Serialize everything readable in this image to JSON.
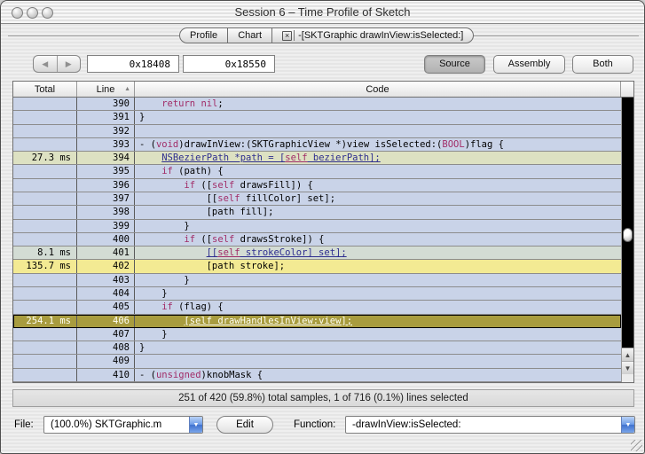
{
  "window": {
    "title": "Session 6 – Time Profile of Sketch"
  },
  "tabs": [
    {
      "label": "Profile"
    },
    {
      "label": "Chart"
    },
    {
      "label": "-[SKTGraphic drawInView:isSelected:]",
      "close_glyph": "×",
      "active": true
    }
  ],
  "toolbar": {
    "back_glyph": "◀",
    "forward_glyph": "▶",
    "address_start": "0x18408",
    "address_end": "0x18550",
    "view_buttons": [
      {
        "label": "Source",
        "selected": true
      },
      {
        "label": "Assembly",
        "selected": false
      },
      {
        "label": "Both",
        "selected": false
      }
    ]
  },
  "table": {
    "columns": {
      "total": "Total",
      "line": "Line",
      "code": "Code"
    },
    "sort_arrow": "▲",
    "rows": [
      {
        "total": "",
        "line": "390",
        "indent": 4,
        "style": "normal",
        "code": [
          {
            "t": "return nil",
            "c": "kw"
          },
          {
            "t": ";",
            "c": "plain"
          }
        ]
      },
      {
        "total": "",
        "line": "391",
        "indent": 0,
        "style": "normal",
        "code": [
          {
            "t": "}",
            "c": "plain"
          }
        ]
      },
      {
        "total": "",
        "line": "392",
        "indent": 0,
        "style": "normal",
        "code": []
      },
      {
        "total": "",
        "line": "393",
        "indent": 0,
        "style": "normal",
        "code": [
          {
            "t": "- (",
            "c": "plain"
          },
          {
            "t": "void",
            "c": "kw"
          },
          {
            "t": ")drawInView:(SKTGraphicView *)view isSelected:(",
            "c": "plain"
          },
          {
            "t": "BOOL",
            "c": "kw"
          },
          {
            "t": ")flag {",
            "c": "plain"
          }
        ]
      },
      {
        "total": "27.3 ms",
        "line": "394",
        "indent": 4,
        "style": "green",
        "code": [
          {
            "t": "NSBezierPath *path = [",
            "c": "link"
          },
          {
            "t": "self",
            "c": "linkkw"
          },
          {
            "t": " bezierPath];",
            "c": "link"
          }
        ]
      },
      {
        "total": "",
        "line": "395",
        "indent": 4,
        "style": "normal",
        "code": [
          {
            "t": "if",
            "c": "kw"
          },
          {
            "t": " (path) {",
            "c": "plain"
          }
        ]
      },
      {
        "total": "",
        "line": "396",
        "indent": 8,
        "style": "normal",
        "code": [
          {
            "t": "if",
            "c": "kw"
          },
          {
            "t": " ([",
            "c": "plain"
          },
          {
            "t": "self",
            "c": "kw"
          },
          {
            "t": " drawsFill]) {",
            "c": "plain"
          }
        ]
      },
      {
        "total": "",
        "line": "397",
        "indent": 12,
        "style": "normal",
        "code": [
          {
            "t": "[[",
            "c": "plain"
          },
          {
            "t": "self",
            "c": "kw"
          },
          {
            "t": " fillColor] set];",
            "c": "plain"
          }
        ]
      },
      {
        "total": "",
        "line": "398",
        "indent": 12,
        "style": "normal",
        "code": [
          {
            "t": "[path fill];",
            "c": "plain"
          }
        ]
      },
      {
        "total": "",
        "line": "399",
        "indent": 8,
        "style": "normal",
        "code": [
          {
            "t": "}",
            "c": "plain"
          }
        ]
      },
      {
        "total": "",
        "line": "400",
        "indent": 8,
        "style": "normal",
        "code": [
          {
            "t": "if",
            "c": "kw"
          },
          {
            "t": " ([",
            "c": "plain"
          },
          {
            "t": "self",
            "c": "kw"
          },
          {
            "t": " drawsStroke]) {",
            "c": "plain"
          }
        ]
      },
      {
        "total": "8.1 ms",
        "line": "401",
        "indent": 12,
        "style": "sage",
        "code": [
          {
            "t": "[[",
            "c": "link"
          },
          {
            "t": "self",
            "c": "linkkw"
          },
          {
            "t": " strokeColor] set];",
            "c": "link"
          }
        ]
      },
      {
        "total": "135.7 ms",
        "line": "402",
        "indent": 12,
        "style": "yellow",
        "code": [
          {
            "t": "[path stroke];",
            "c": "plain"
          }
        ]
      },
      {
        "total": "",
        "line": "403",
        "indent": 8,
        "style": "normal",
        "code": [
          {
            "t": "}",
            "c": "plain"
          }
        ]
      },
      {
        "total": "",
        "line": "404",
        "indent": 4,
        "style": "normal",
        "code": [
          {
            "t": "}",
            "c": "plain"
          }
        ]
      },
      {
        "total": "",
        "line": "405",
        "indent": 4,
        "style": "normal",
        "code": [
          {
            "t": "if",
            "c": "kw"
          },
          {
            "t": " (flag) {",
            "c": "plain"
          }
        ]
      },
      {
        "total": "254.1 ms",
        "line": "406",
        "indent": 8,
        "style": "selected",
        "code": [
          {
            "t": "[self drawHandlesInView:view];",
            "c": "sel"
          }
        ]
      },
      {
        "total": "",
        "line": "407",
        "indent": 4,
        "style": "normal",
        "code": [
          {
            "t": "}",
            "c": "plain"
          }
        ]
      },
      {
        "total": "",
        "line": "408",
        "indent": 0,
        "style": "normal",
        "code": [
          {
            "t": "}",
            "c": "plain"
          }
        ]
      },
      {
        "total": "",
        "line": "409",
        "indent": 0,
        "style": "normal",
        "code": []
      },
      {
        "total": "",
        "line": "410",
        "indent": 0,
        "style": "normal",
        "code": [
          {
            "t": "- (",
            "c": "plain"
          },
          {
            "t": "unsigned",
            "c": "kw"
          },
          {
            "t": ")knobMask {",
            "c": "plain"
          }
        ]
      }
    ]
  },
  "scrollbar": {
    "up_glyph": "▲",
    "down_glyph": "▼",
    "thumb_position_pct": 52
  },
  "status": "251 of 420 (59.8%) total samples, 1 of 716 (0.1%) lines selected",
  "footer": {
    "file_label": "File:",
    "file_value": "(100.0%) SKTGraphic.m",
    "edit_label": "Edit",
    "function_label": "Function:",
    "function_value": "-drawInView:isSelected:",
    "popup_arrow_glyph": "▼"
  },
  "colors": {
    "row_normal": "#c9d3e8",
    "row_sample_green": "#dde1c2",
    "row_sample_sage": "#d3dcd4",
    "row_sample_yellow": "#f3ea93",
    "row_selected": "#a89c3f",
    "keyword": "#a12d68",
    "link": "#2e2e8f",
    "plain": "#000000",
    "selected_text": "#fffff2",
    "accent_blue": "#4a7fd8"
  }
}
